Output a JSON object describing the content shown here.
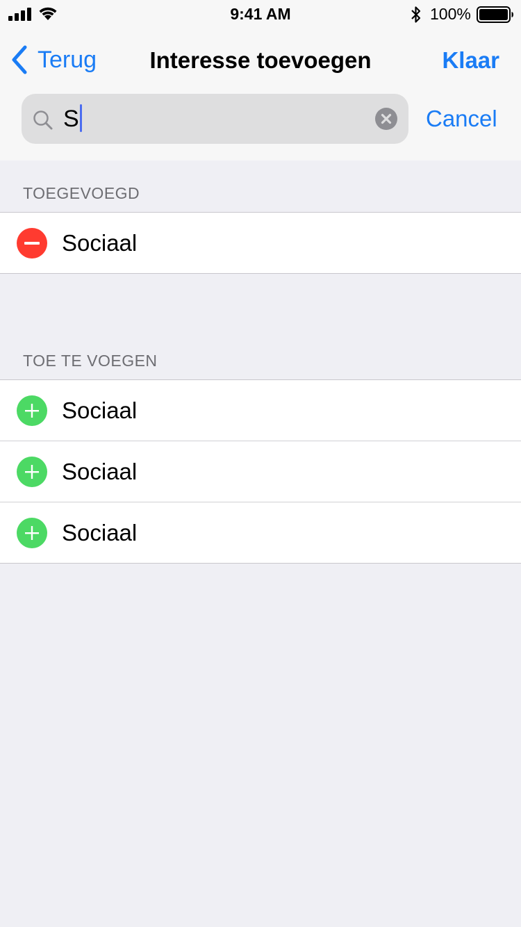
{
  "status_bar": {
    "time": "9:41 AM",
    "battery_percent": "100%",
    "icons": [
      "signal-icon",
      "wifi-icon",
      "bluetooth-icon",
      "battery-icon"
    ]
  },
  "nav": {
    "back_label": "Terug",
    "title": "Interesse toevoegen",
    "done_label": "Klaar"
  },
  "search": {
    "value": "S",
    "cancel_label": "Cancel"
  },
  "added": {
    "header": "TOEGEVOEGD",
    "items": [
      {
        "label": "Sociaal",
        "icon": "remove-circle-icon"
      }
    ]
  },
  "to_add": {
    "header": "TOE TE VOEGEN",
    "items": [
      {
        "label": "Sociaal",
        "icon": "add-circle-icon"
      },
      {
        "label": "Sociaal",
        "icon": "add-circle-icon"
      },
      {
        "label": "Sociaal",
        "icon": "add-circle-icon"
      }
    ]
  },
  "colors": {
    "accent": "#1a7cf5",
    "remove": "#ff3b30",
    "add": "#4cd964",
    "background": "#efeff4"
  }
}
